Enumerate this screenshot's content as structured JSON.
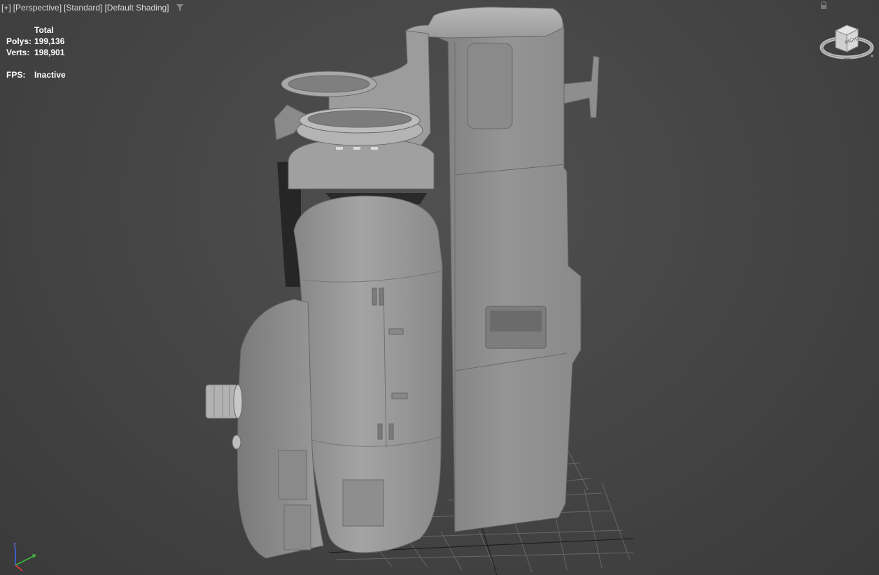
{
  "viewport": {
    "plus_label": "[+]",
    "view_label": "[Perspective]",
    "preset_label": "[Standard]",
    "shading_label": "[Default Shading]"
  },
  "stats": {
    "header": "Total",
    "polys_label": "Polys:",
    "polys_value": "199,136",
    "verts_label": "Verts:",
    "verts_value": "198,901",
    "fps_label": "FPS:",
    "fps_value": "Inactive"
  },
  "viewcube": {
    "face_label": "RIGHT"
  },
  "gizmo": {
    "z_label": "z"
  },
  "colors": {
    "background": "#444444",
    "model": "#8c8c8c",
    "grid": "#6a6a6a",
    "text": "#ffffff"
  }
}
